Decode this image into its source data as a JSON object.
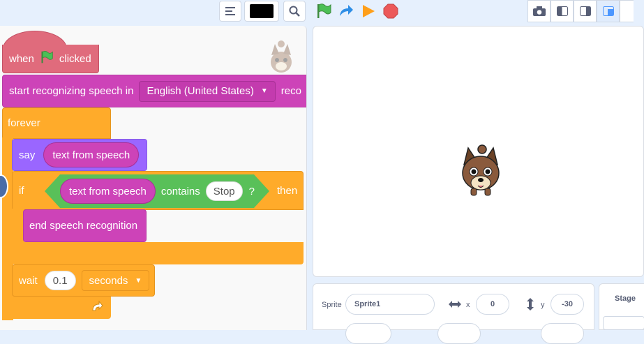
{
  "toolbar": {
    "icons": [
      "list-icon",
      "color-swatch",
      "search-icon",
      "green-flag-icon",
      "redo-icon",
      "run-icon",
      "stop-icon",
      "camera-icon",
      "small-stage-icon",
      "normal-stage-icon",
      "fullscreen-layout-icon"
    ],
    "swatch_color": "#000000"
  },
  "code": {
    "hat": {
      "when": "when",
      "clicked": "clicked"
    },
    "start_block": {
      "text": "start recognizing speech in",
      "language": "English (United States)",
      "trailing": "reco"
    },
    "forever": "forever",
    "say": {
      "label": "say",
      "reporter": "text from speech"
    },
    "if_block": {
      "if": "if",
      "reporter": "text from speech",
      "contains": "contains",
      "value": "Stop",
      "qmark": "?",
      "then": "then"
    },
    "end_block": "end speech recognition",
    "wait": {
      "label": "wait",
      "value": "0.1",
      "unit": "seconds"
    }
  },
  "sprite_info": {
    "sprite_label": "Sprite",
    "sprite_name": "Sprite1",
    "x_label": "x",
    "x_value": "0",
    "y_label": "y",
    "y_value": "-30"
  },
  "stage_panel": {
    "label": "Stage"
  },
  "colors": {
    "events": "#e06b7c",
    "extension": "#cd43b8",
    "control": "#ffab2a",
    "looks": "#9a66ff",
    "operators": "#59c059"
  }
}
